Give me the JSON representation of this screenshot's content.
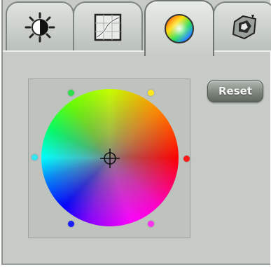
{
  "tabs": [
    {
      "name": "brightness-contrast",
      "icon": "brightness-contrast-icon",
      "selected": false
    },
    {
      "name": "curves",
      "icon": "curves-graph-icon",
      "selected": false
    },
    {
      "name": "color-balance",
      "icon": "color-wheel-icon",
      "selected": true
    },
    {
      "name": "effects",
      "icon": "image-effects-icon",
      "selected": false
    }
  ],
  "picker": {
    "reset_label": "Reset",
    "handles": [
      {
        "name": "green",
        "color": "#2ee04a"
      },
      {
        "name": "yellow",
        "color": "#ffe81c"
      },
      {
        "name": "cyan",
        "color": "#33e3f0"
      },
      {
        "name": "red",
        "color": "#ff1a1a"
      },
      {
        "name": "blue",
        "color": "#1a1aff"
      },
      {
        "name": "magenta",
        "color": "#ff33ee"
      }
    ]
  },
  "colors": {
    "panel": "#c6cbc6",
    "picker_bg": "#bec3be",
    "button": "#7f877f"
  }
}
